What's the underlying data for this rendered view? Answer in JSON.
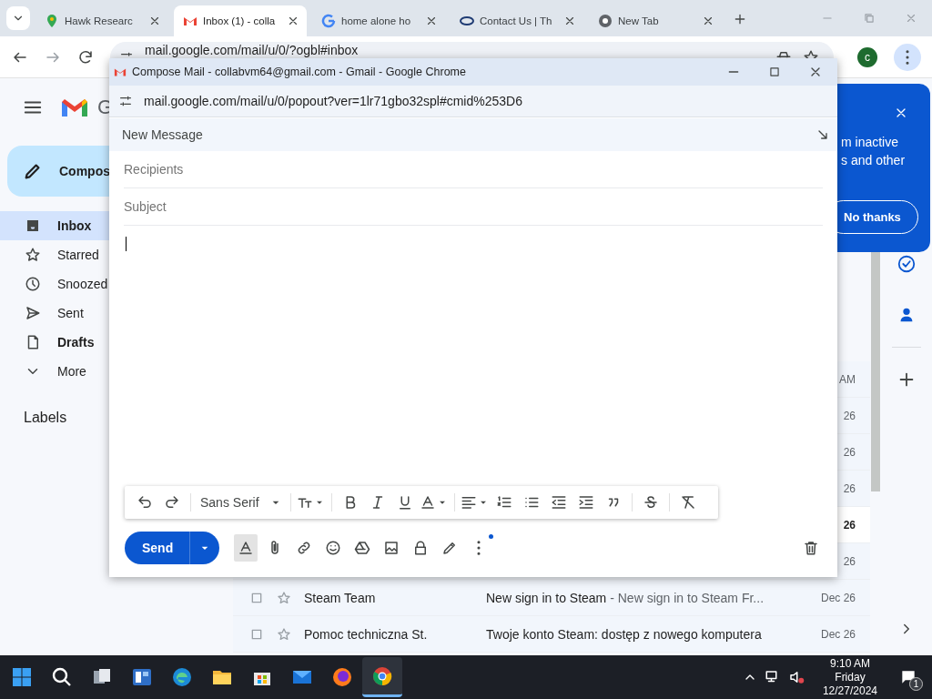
{
  "browser": {
    "tabs": [
      {
        "title": "Hawk Researc",
        "kind": "maps",
        "selected": false
      },
      {
        "title": "Inbox (1) - colla",
        "kind": "gmail",
        "selected": true
      },
      {
        "title": "home alone ho",
        "kind": "google",
        "selected": false
      },
      {
        "title": "Contact Us | Th",
        "kind": "oval",
        "selected": false
      },
      {
        "title": "New Tab",
        "kind": "chrome",
        "selected": false
      }
    ],
    "address": "mail.google.com/mail/u/0/?ogbl#inbox",
    "profile_initial": "c"
  },
  "gmail": {
    "logo_text": "G",
    "compose_label": "Compos",
    "nav": [
      {
        "label": "Inbox",
        "kind": "inbox",
        "selected": true,
        "unread": true
      },
      {
        "label": "Starred",
        "kind": "star",
        "selected": false,
        "unread": false
      },
      {
        "label": "Snoozed",
        "kind": "clock",
        "selected": false,
        "unread": false
      },
      {
        "label": "Sent",
        "kind": "send",
        "selected": false,
        "unread": false
      },
      {
        "label": "Drafts",
        "kind": "draft",
        "selected": false,
        "unread": true
      },
      {
        "label": "More",
        "kind": "chevdown",
        "selected": false,
        "unread": false
      }
    ],
    "labels_heading": "Labels",
    "rows": [
      {
        "date": "AM",
        "unread": false
      },
      {
        "date": "26",
        "unread": false
      },
      {
        "date": "26",
        "unread": false
      },
      {
        "date": "26",
        "unread": false
      },
      {
        "date": "26",
        "unread": true
      },
      {
        "date": "26",
        "unread": false
      },
      {
        "sender": "Steam Team",
        "subject": "New sign in to Steam",
        "snippet": " - New sign in to Steam Fr...",
        "date": "Dec 26",
        "unread": false
      },
      {
        "sender": "Pomoc techniczna St.",
        "subject": "Twoje konto Steam: dostęp z nowego komputera",
        "date": "Dec 26",
        "unread": false
      }
    ],
    "promo": {
      "lines": [
        "m inactive",
        "s and other"
      ],
      "button": "No thanks"
    }
  },
  "compose_window": {
    "title": "Compose Mail - collabvm64@gmail.com - Gmail - Google Chrome",
    "address": "mail.google.com/mail/u/0/popout?ver=1lr71gbo32spl#cmid%253D6",
    "header": "New Message",
    "recipients_placeholder": "Recipients",
    "subject_placeholder": "Subject",
    "font": "Sans Serif",
    "send": "Send"
  },
  "taskbar": {
    "apps": [
      {
        "kind": "start",
        "selected": false
      },
      {
        "kind": "search",
        "selected": false
      },
      {
        "kind": "taskview",
        "selected": false
      },
      {
        "kind": "widgets",
        "selected": false
      },
      {
        "kind": "edge",
        "selected": false
      },
      {
        "kind": "explorer",
        "selected": false
      },
      {
        "kind": "store",
        "selected": false
      },
      {
        "kind": "mail",
        "selected": false
      },
      {
        "kind": "firefox",
        "selected": false
      },
      {
        "kind": "chrome",
        "selected": true
      }
    ],
    "time": "9:10 AM",
    "day": "Friday",
    "date": "12/27/2024",
    "notifications": "1"
  }
}
